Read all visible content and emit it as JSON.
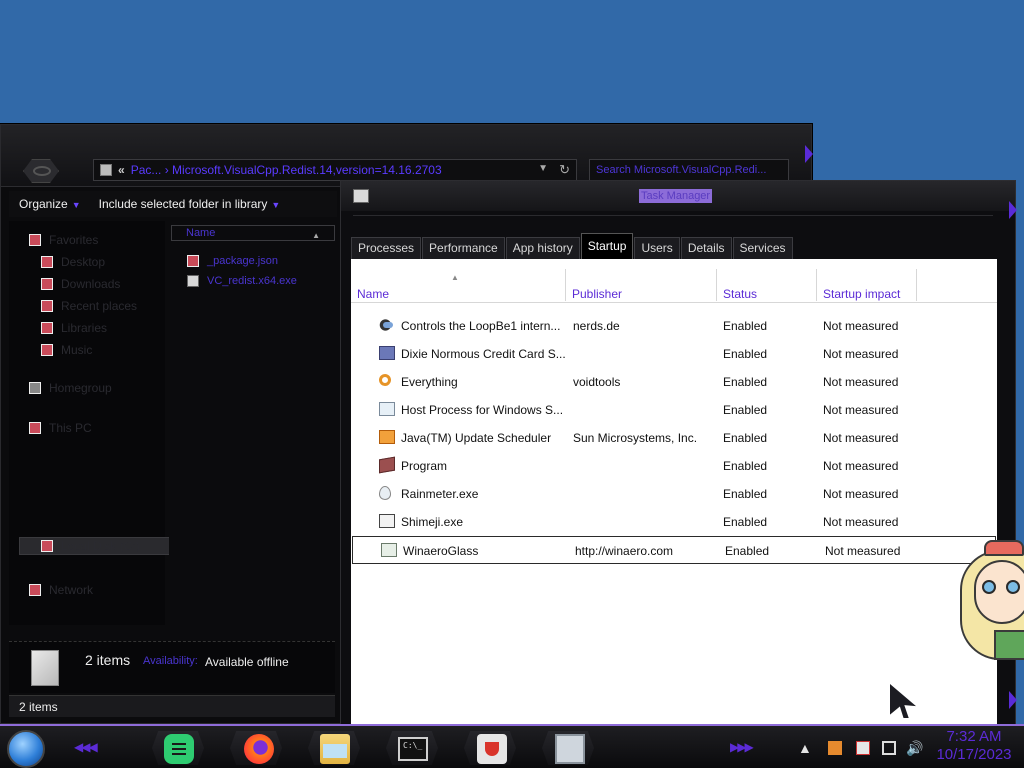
{
  "explorer": {
    "address_chevron": "«",
    "address_path": "Pac...  ›  Microsoft.VisualCpp.Redist.14,version=14.16.2703",
    "search_placeholder": "Search Microsoft.VisualCpp.Redi...",
    "toolbar": {
      "organize_label": "Organize",
      "include_label": "Include selected folder in library"
    },
    "file_column": "Name",
    "files": [
      {
        "name": "_package.json",
        "icon": "json-file-icon"
      },
      {
        "name": "VC_redist.x64.exe",
        "icon": "installer-exe-icon"
      }
    ],
    "details": {
      "count": "2 items",
      "availability_label": "Availability:",
      "availability_value": "Available offline"
    },
    "status_bar": "2 items"
  },
  "taskmgr": {
    "title": "Task Manager",
    "tabs": [
      "Processes",
      "Performance",
      "App history",
      "Startup",
      "Users",
      "Details",
      "Services"
    ],
    "active_tab": "Startup",
    "columns": {
      "name": "Name",
      "publisher": "Publisher",
      "status": "Status",
      "impact": "Startup impact"
    },
    "rows": [
      {
        "name": "Controls the LoopBe1 intern...",
        "publisher": "nerds.de",
        "status": "Enabled",
        "impact": "Not measured",
        "icon": "loopbe-icon"
      },
      {
        "name": "Dixie Normous Credit Card S...",
        "publisher": "",
        "status": "Enabled",
        "impact": "Not measured",
        "icon": "credit-card-icon"
      },
      {
        "name": "Everything",
        "publisher": "voidtools",
        "status": "Enabled",
        "impact": "Not measured",
        "icon": "magnifier-icon"
      },
      {
        "name": "Host Process for Windows S...",
        "publisher": "",
        "status": "Enabled",
        "impact": "Not measured",
        "icon": "host-process-icon"
      },
      {
        "name": "Java(TM) Update Scheduler",
        "publisher": "Sun Microsystems, Inc.",
        "status": "Enabled",
        "impact": "Not measured",
        "icon": "java-icon"
      },
      {
        "name": "Program",
        "publisher": "",
        "status": "Enabled",
        "impact": "Not measured",
        "icon": "program-icon"
      },
      {
        "name": "Rainmeter.exe",
        "publisher": "",
        "status": "Enabled",
        "impact": "Not measured",
        "icon": "raindrop-icon"
      },
      {
        "name": "Shimeji.exe",
        "publisher": "",
        "status": "Enabled",
        "impact": "Not measured",
        "icon": "shimeji-icon"
      },
      {
        "name": "WinaeroGlass",
        "publisher": "http://winaero.com",
        "status": "Enabled",
        "impact": "Not measured",
        "icon": "winaero-glass-icon"
      }
    ],
    "selected_row": 8
  },
  "taskbar": {
    "clock_time": "7:32 AM",
    "clock_date": "10/17/2023",
    "apps": [
      "sticky-notes-icon",
      "firefox-icon",
      "file-explorer-icon",
      "command-prompt-icon",
      "java-icon",
      "resource-monitor-icon"
    ]
  },
  "colors": {
    "accent_purple": "#5b2bd6",
    "desktop_blue": "#3169a8",
    "window_black": "#0b0b0d"
  }
}
